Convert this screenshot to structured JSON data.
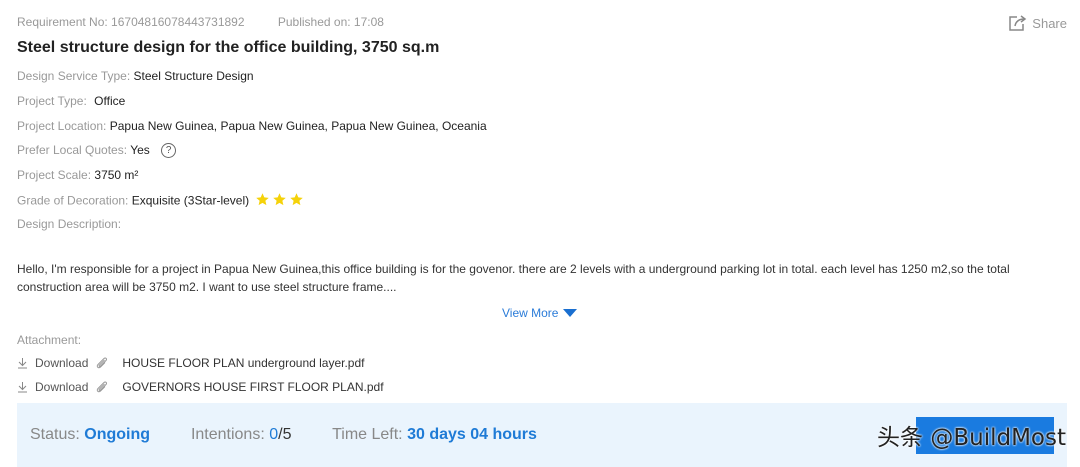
{
  "header": {
    "requirement_no": "Requirement No: 16704816078443731892",
    "published": "Published on: 17:08",
    "share_label": "Share"
  },
  "title": "Steel structure design for the office building, 3750 sq.m",
  "fields": {
    "design_service_type": {
      "label": "Design Service Type:",
      "value": "Steel Structure Design"
    },
    "project_type": {
      "label": "Project Type:",
      "value": "Office"
    },
    "project_location": {
      "label": "Project Location:",
      "value": "Papua New Guinea, Papua New Guinea, Papua New Guinea, Oceania"
    },
    "prefer_local_quotes": {
      "label": "Prefer Local Quotes:",
      "value": "Yes",
      "help_glyph": "?"
    },
    "project_scale": {
      "label": "Project Scale:",
      "value": "3750 m²"
    },
    "grade_of_decoration": {
      "label": "Grade of Decoration:",
      "value": "Exquisite (3Star-level)",
      "stars": 3,
      "star_color": "#f5d20a"
    },
    "design_description": {
      "label": "Design Description:"
    }
  },
  "description": "Hello, I'm responsible for a project in Papua New Guinea,this office building is for the govenor. there are 2 levels with a underground parking lot in total. each level has 1250 m2,so the total construction area will be 3750 m2. I want to use steel structure frame....",
  "view_more_label": "View More",
  "attachments": {
    "label": "Attachment:",
    "items": [
      {
        "download_label": "Download",
        "file_name": "HOUSE FLOOR PLAN underground layer.pdf"
      },
      {
        "download_label": "Download",
        "file_name": "GOVERNORS HOUSE FIRST FLOOR PLAN.pdf"
      }
    ]
  },
  "status_bar": {
    "status_label": "Status:",
    "status_value": "Ongoing",
    "intentions_label": "Intentions:",
    "intentions_current": "0",
    "intentions_total": "/5",
    "time_left_label": "Time Left:",
    "time_left_value": "30 days 04 hours",
    "accent_color": "#1f7bd6"
  },
  "watermark": "头条 @BuildMost"
}
